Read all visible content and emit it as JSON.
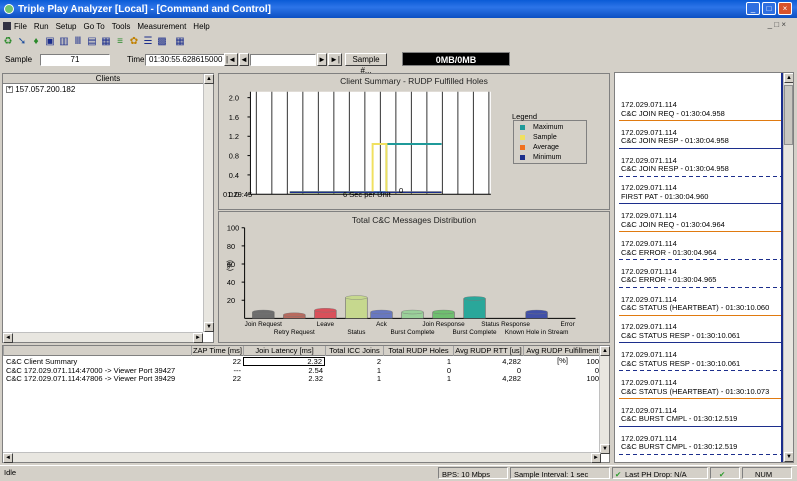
{
  "window": {
    "title": "Triple Play Analyzer [Local] - [Command and Control]",
    "min": "_",
    "max": "□",
    "close": "×"
  },
  "menu": [
    "File",
    "Run",
    "Setup",
    "Go To",
    "Tools",
    "Measurement",
    "Help"
  ],
  "toolbar": {
    "icons": [
      "open-icon",
      "cursor-icon",
      "record-icon",
      "save-icon",
      "chart-icon",
      "filter-icon",
      "table-icon",
      "stats-icon",
      "graph-icon",
      "settings-icon",
      "list-icon",
      "monitor-icon"
    ]
  },
  "sample_row": {
    "sample_label": "Sample",
    "sample_value": "71",
    "time_label": "Time",
    "time_value": "01:30:55.628615000",
    "first_btn": "|◄",
    "prev_btn": "◄",
    "next_btn": "►",
    "last_btn": "►|",
    "sample_num_btn": "Sample #...",
    "counter": "0MB/0MB"
  },
  "clients": {
    "header": "Clients",
    "items": [
      "157.057.200.182"
    ]
  },
  "chart_top": {
    "title": "Client Summary - RUDP Fulfilled Holes",
    "x_start": "01:29:45",
    "x_unit": "6 Sec per Unit",
    "x_end": "0",
    "legend_title": "Legend",
    "legend": [
      {
        "name": "Maximum",
        "color": "#1f9a9a"
      },
      {
        "name": "Sample",
        "color": "#f0e060"
      },
      {
        "name": "Average",
        "color": "#f07020"
      },
      {
        "name": "Minimum",
        "color": "#1c2e8c"
      }
    ],
    "y_ticks": [
      "2.0",
      "1.6",
      "1.2",
      "0.8",
      "0.4",
      "0.0"
    ]
  },
  "chart_data": [
    {
      "type": "line",
      "title": "Client Summary - RUDP Fulfilled Holes",
      "xlabel": "6 Sec per Unit",
      "ylim": [
        0,
        2
      ],
      "series": [
        {
          "name": "Maximum",
          "values": [
            0,
            0,
            0,
            0,
            0,
            0,
            0,
            1,
            1,
            1,
            1,
            1
          ]
        },
        {
          "name": "Sample",
          "values": [
            0,
            0,
            0,
            0,
            0,
            0,
            1,
            0,
            0,
            0,
            0,
            0
          ]
        },
        {
          "name": "Average",
          "values": [
            0,
            0,
            0,
            0,
            0,
            0,
            0,
            0,
            0,
            0,
            0,
            0
          ]
        },
        {
          "name": "Minimum",
          "values": [
            0,
            0,
            0,
            0,
            0,
            0,
            0,
            0,
            0,
            0,
            0,
            0
          ]
        }
      ]
    },
    {
      "type": "bar",
      "title": "Total C&C Messages Distribution",
      "ylabel": "(%)",
      "ylim": [
        0,
        100
      ],
      "y_ticks": [
        "100",
        "80",
        "60",
        "40",
        "20"
      ],
      "categories": [
        "Join Request",
        "Retry Request",
        "Leave",
        "Status",
        "Ack",
        "Burst Complete",
        "Join Response",
        "Burst Complete",
        "Status Response",
        "Known Hole in Stream",
        "Error"
      ],
      "values": [
        7,
        4,
        9,
        23,
        7,
        7,
        7,
        22,
        0,
        7,
        0
      ],
      "colors": [
        "#6d6d6d",
        "#b86a5e",
        "#d9505a",
        "#c6d88e",
        "#6878c0",
        "#9ad09a",
        "#6fbf6f",
        "#2aa79a",
        "#8888aa",
        "#4050a8",
        "#a0a0c0"
      ]
    }
  ],
  "chart_bottom": {
    "title": "Total C&C Messages Distribution",
    "ylabel": "(%)"
  },
  "table": {
    "headers": [
      "",
      "ZAP Time [ms]",
      "Join Latency [ms]",
      "Total ICC Joins",
      "Total RUDP Holes",
      "Avg RUDP RTT [us]",
      "Avg RUDP Fulfillment [%]"
    ],
    "rows": [
      [
        "C&C Client Summary",
        "22",
        "2.32",
        "2",
        "1",
        "4,282",
        "100"
      ],
      [
        "C&C 172.029.071.114:47000 -> Viewer Port 39427",
        "---",
        "2.54",
        "1",
        "0",
        "0",
        "0"
      ],
      [
        "C&C 172.029.071.114:47806 -> Viewer Port 39429",
        "22",
        "2.32",
        "1",
        "1",
        "4,282",
        "100"
      ]
    ]
  },
  "events": [
    {
      "ip": "172.029.071.114",
      "msg": "C&C JOIN REQ - 01:30:04.958",
      "style": "orange"
    },
    {
      "ip": "172.029.071.114",
      "msg": "C&C JOIN RESP - 01:30:04.958",
      "style": "blue"
    },
    {
      "ip": "172.029.071.114",
      "msg": "C&C JOIN RESP - 01:30:04.958",
      "style": "dash"
    },
    {
      "ip": "172.029.071.114",
      "msg": "FIRST PAT - 01:30:04.960",
      "style": "blue"
    },
    {
      "ip": "172.029.071.114",
      "msg": "C&C JOIN REQ - 01:30:04.964",
      "style": "orange"
    },
    {
      "ip": "172.029.071.114",
      "msg": "C&C ERROR - 01:30:04.964",
      "style": "dash"
    },
    {
      "ip": "172.029.071.114",
      "msg": "C&C ERROR - 01:30:04.965",
      "style": "dash"
    },
    {
      "ip": "172.029.071.114",
      "msg": "C&C STATUS (HEARTBEAT) - 01:30:10.060",
      "style": "orange"
    },
    {
      "ip": "172.029.071.114",
      "msg": "C&C STATUS RESP - 01:30:10.061",
      "style": "blue"
    },
    {
      "ip": "172.029.071.114",
      "msg": "C&C STATUS RESP - 01:30:10.061",
      "style": "dash"
    },
    {
      "ip": "172.029.071.114",
      "msg": "C&C STATUS (HEARTBEAT) - 01:30:10.073",
      "style": "orange"
    },
    {
      "ip": "172.029.071.114",
      "msg": "C&C BURST CMPL - 01:30:12.519",
      "style": "blue"
    },
    {
      "ip": "172.029.071.114",
      "msg": "C&C BURST CMPL - 01:30:12.519",
      "style": "dash"
    }
  ],
  "status": {
    "left": "Idle",
    "bps": "BPS: 10 Mbps",
    "interval": "Sample Interval: 1 sec",
    "last_ph": "Last PH Drop: N/A",
    "num": "NUM"
  }
}
